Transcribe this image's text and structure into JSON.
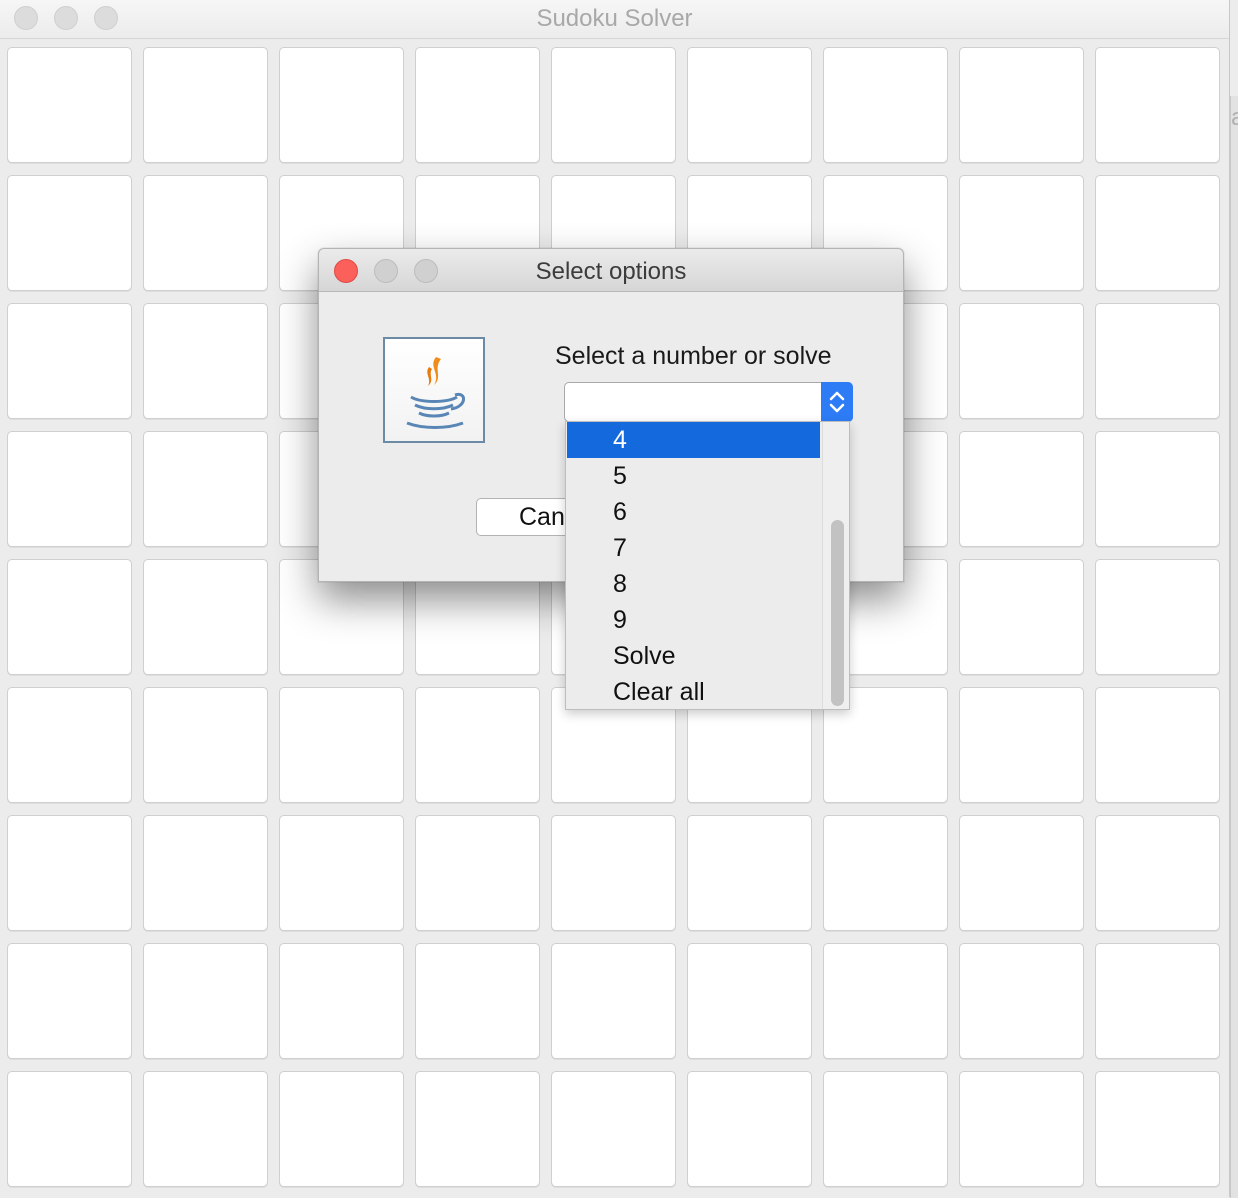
{
  "window": {
    "title": "Sudoku Solver",
    "cell_rows": 9,
    "cell_cols": 9
  },
  "dialog": {
    "title": "Select options",
    "icon": "java-coffee-cup-icon",
    "prompt": "Select a number or solve",
    "combo_value": "",
    "cancel_label_visible": "Can"
  },
  "dropdown": {
    "items": [
      "4",
      "5",
      "6",
      "7",
      "8",
      "9",
      "Solve",
      "Clear all"
    ],
    "selected": "4",
    "highlight_color": "#1469dc"
  },
  "colors": {
    "close_button": "#fc605b",
    "combo_arrow_accent": "#2d7cf6"
  }
}
